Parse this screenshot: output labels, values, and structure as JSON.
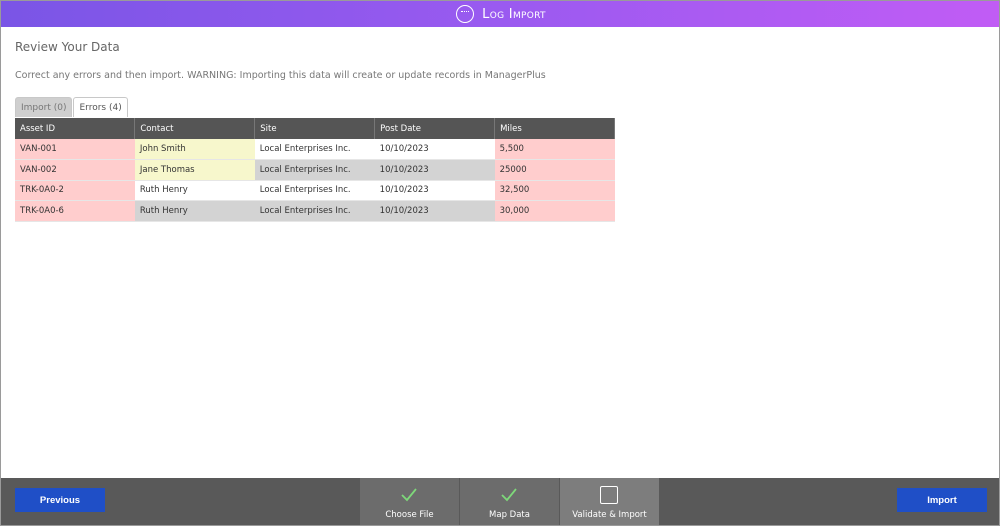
{
  "window": {
    "title": "Log Import"
  },
  "page": {
    "heading": "Review Your Data",
    "subheading": "Correct any errors and then import. WARNING: Importing this data will create or update records in ManagerPlus"
  },
  "tabs": [
    {
      "label": "Import (0)"
    },
    {
      "label": "Errors (4)"
    }
  ],
  "table": {
    "columns": [
      "Asset ID",
      "Contact",
      "Site",
      "Post Date",
      "Miles"
    ],
    "rows": [
      [
        "VAN-001",
        "John Smith",
        "Local Enterprises Inc.",
        "10/10/2023",
        "5,500"
      ],
      [
        "VAN-002",
        "Jane Thomas",
        "Local Enterprises Inc.",
        "10/10/2023",
        "25000"
      ],
      [
        "TRK-0A0-2",
        "Ruth Henry",
        "Local Enterprises Inc.",
        "10/10/2023",
        "32,500"
      ],
      [
        "TRK-0A0-6",
        "Ruth Henry",
        "Local Enterprises Inc.",
        "10/10/2023",
        "30,000"
      ]
    ]
  },
  "footer": {
    "previous_label": "Previous",
    "import_label": "Import",
    "steps": [
      {
        "label": "Choose File",
        "icon": "check-icon",
        "state": "done"
      },
      {
        "label": "Map Data",
        "icon": "check-icon",
        "state": "done"
      },
      {
        "label": "Validate & Import",
        "icon": "empty-box-icon",
        "state": "current"
      }
    ]
  },
  "colors": {
    "header_gradient_start": "#7a55e6",
    "header_gradient_end": "#c15cf5",
    "error_cell": "#ffcdcd",
    "warning_cell": "#f7f7cc",
    "button": "#1f4fc7",
    "check": "#7ed87a"
  }
}
